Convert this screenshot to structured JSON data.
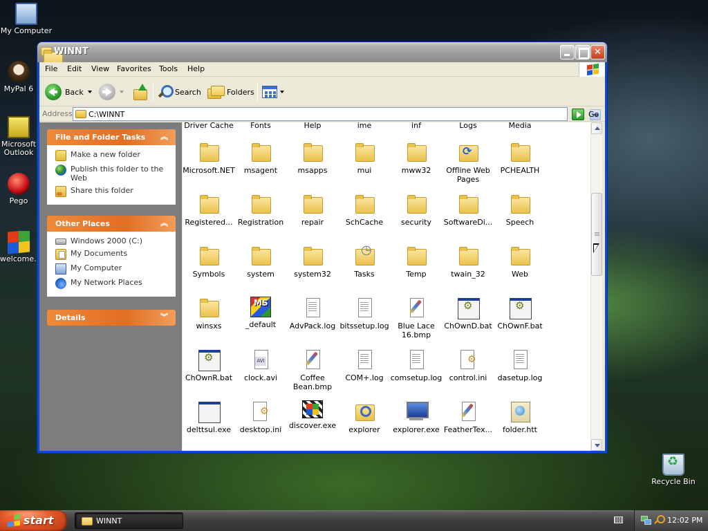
{
  "desktop": {
    "icons": [
      {
        "label": "My Computer",
        "icon": "computer-icon"
      },
      {
        "label": "MyPal 6",
        "icon": "mypal-icon"
      },
      {
        "label": "Microsoft Outlook",
        "icon": "outlook-icon"
      },
      {
        "label": "Pego",
        "icon": "pego-icon"
      },
      {
        "label": "welcome.exe",
        "icon": "windows-flag-icon"
      },
      {
        "label": "Recycle Bin",
        "icon": "recycle-bin-icon"
      }
    ]
  },
  "window": {
    "title": "WINNT",
    "menu": [
      "File",
      "Edit",
      "View",
      "Favorites",
      "Tools",
      "Help"
    ],
    "toolbar": {
      "back_label": "Back",
      "search_label": "Search",
      "folders_label": "Folders"
    },
    "address": {
      "label": "Address",
      "value": "C:\\WINNT",
      "go_label": "Go"
    }
  },
  "taskpane": {
    "file_tasks": {
      "title": "File and Folder Tasks",
      "items": [
        {
          "label": "Make a new folder",
          "icon": "new-folder-icon"
        },
        {
          "label": "Publish this folder to the Web",
          "icon": "publish-web-icon"
        },
        {
          "label": "Share this folder",
          "icon": "share-folder-icon"
        }
      ]
    },
    "other_places": {
      "title": "Other Places",
      "items": [
        {
          "label": "Windows 2000 (C:)",
          "icon": "drive-icon"
        },
        {
          "label": "My Documents",
          "icon": "my-documents-icon"
        },
        {
          "label": "My Computer",
          "icon": "my-computer-icon"
        },
        {
          "label": "My Network Places",
          "icon": "network-places-icon"
        }
      ]
    },
    "details": {
      "title": "Details"
    }
  },
  "files": {
    "partial_row": [
      "Driver Cache",
      "Fonts",
      "Help",
      "ime",
      "inf",
      "Logs",
      "Media"
    ],
    "rows": [
      [
        {
          "label": "Microsoft.NET",
          "type": "folder"
        },
        {
          "label": "msagent",
          "type": "folder"
        },
        {
          "label": "msapps",
          "type": "folder"
        },
        {
          "label": "mui",
          "type": "folder"
        },
        {
          "label": "mww32",
          "type": "folder"
        },
        {
          "label": "Offline Web Pages",
          "type": "folder-special"
        },
        {
          "label": "PCHEALTH",
          "type": "folder"
        }
      ],
      [
        {
          "label": "Registered...",
          "type": "folder"
        },
        {
          "label": "Registration",
          "type": "folder"
        },
        {
          "label": "repair",
          "type": "folder"
        },
        {
          "label": "SchCache",
          "type": "folder"
        },
        {
          "label": "security",
          "type": "folder"
        },
        {
          "label": "SoftwareDi...",
          "type": "folder"
        },
        {
          "label": "Speech",
          "type": "folder"
        }
      ],
      [
        {
          "label": "Symbols",
          "type": "folder"
        },
        {
          "label": "system",
          "type": "folder"
        },
        {
          "label": "system32",
          "type": "folder"
        },
        {
          "label": "Tasks",
          "type": "folder-tasks"
        },
        {
          "label": "Temp",
          "type": "folder"
        },
        {
          "label": "twain_32",
          "type": "folder"
        },
        {
          "label": "Web",
          "type": "folder"
        }
      ],
      [
        {
          "label": "winsxs",
          "type": "folder"
        },
        {
          "label": "_default",
          "type": "msmq"
        },
        {
          "label": "AdvPack.log",
          "type": "doc"
        },
        {
          "label": "bitssetup.log",
          "type": "doc"
        },
        {
          "label": "Blue Lace 16.bmp",
          "type": "bmp"
        },
        {
          "label": "ChOwnD.bat",
          "type": "bat"
        },
        {
          "label": "ChOwnF.bat",
          "type": "bat"
        }
      ],
      [
        {
          "label": "ChOwnR.bat",
          "type": "bat"
        },
        {
          "label": "clock.avi",
          "type": "avi"
        },
        {
          "label": "Coffee Bean.bmp",
          "type": "bmp"
        },
        {
          "label": "COM+.log",
          "type": "doc"
        },
        {
          "label": "comsetup.log",
          "type": "doc"
        },
        {
          "label": "control.ini",
          "type": "ini"
        },
        {
          "label": "dasetup.log",
          "type": "doc"
        }
      ],
      [
        {
          "label": "delttsul.exe",
          "type": "exe"
        },
        {
          "label": "desktop.ini",
          "type": "ini"
        },
        {
          "label": "discover.exe",
          "type": "discover"
        },
        {
          "label": "explorer",
          "type": "explorer-folder"
        },
        {
          "label": "explorer.exe",
          "type": "monitor"
        },
        {
          "label": "FeatherTex...",
          "type": "bmp"
        },
        {
          "label": "folder.htt",
          "type": "htt"
        }
      ]
    ]
  },
  "taskbar": {
    "start_label": "start",
    "task_button_label": "WINNT",
    "clock": "12:02 PM"
  }
}
